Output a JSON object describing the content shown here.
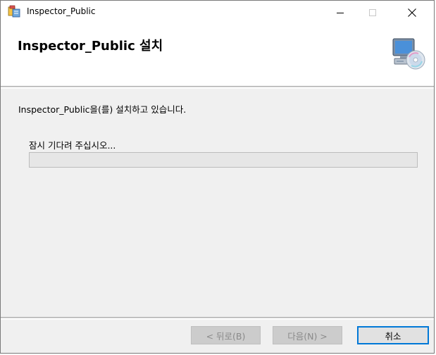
{
  "window": {
    "title": "Inspector_Public",
    "app_icon": "installer-icon",
    "controls": {
      "minimize_icon": "minimize-icon",
      "maximize_icon": "maximize-icon",
      "close_icon": "close-icon"
    }
  },
  "banner": {
    "title": "Inspector_Public 설치",
    "art_icon": "computer-cd-icon"
  },
  "body": {
    "status_text": "Inspector_Public을(를) 설치하고 있습니다.",
    "wait_text": "잠시 기다려 주십시오...",
    "progress_percent": 0
  },
  "buttons": {
    "back_label": "< 뒤로(B)",
    "next_label": "다음(N) >",
    "cancel_label": "취소"
  },
  "colors": {
    "accent": "#0078d7",
    "progress_track": "#e6e6e6",
    "progress_fill": "#06b025",
    "dialog_bg": "#f0f0f0"
  }
}
